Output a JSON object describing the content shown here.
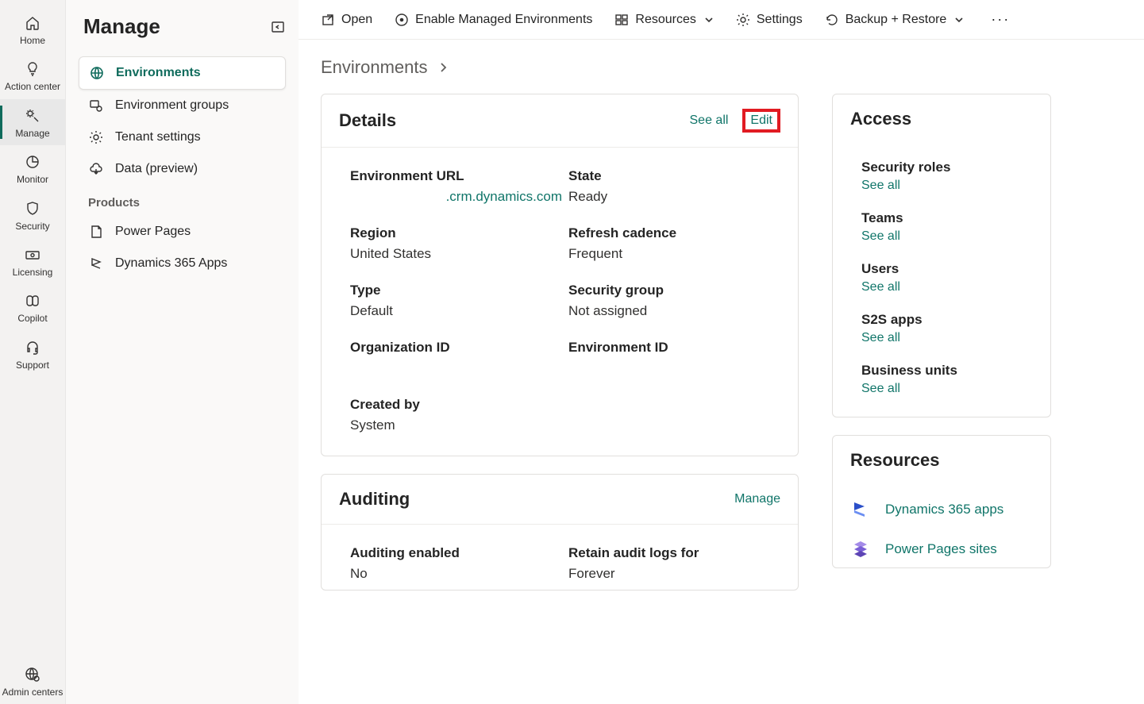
{
  "rail": {
    "items": [
      {
        "label": "Home"
      },
      {
        "label": "Action center"
      },
      {
        "label": "Manage"
      },
      {
        "label": "Monitor"
      },
      {
        "label": "Security"
      },
      {
        "label": "Licensing"
      },
      {
        "label": "Copilot"
      },
      {
        "label": "Support"
      }
    ],
    "footer": {
      "label": "Admin centers"
    }
  },
  "sidebar": {
    "title": "Manage",
    "items": [
      {
        "label": "Environments"
      },
      {
        "label": "Environment groups"
      },
      {
        "label": "Tenant settings"
      },
      {
        "label": "Data (preview)"
      }
    ],
    "section_products": "Products",
    "products": [
      {
        "label": "Power Pages"
      },
      {
        "label": "Dynamics 365 Apps"
      }
    ]
  },
  "toolbar": {
    "open": "Open",
    "enable_managed": "Enable Managed Environments",
    "resources": "Resources",
    "settings": "Settings",
    "backup_restore": "Backup + Restore"
  },
  "breadcrumb": {
    "root": "Environments"
  },
  "details": {
    "title": "Details",
    "see_all": "See all",
    "edit": "Edit",
    "fields": {
      "env_url_label": "Environment URL",
      "env_url_value": ".crm.dynamics.com",
      "state_label": "State",
      "state_value": "Ready",
      "region_label": "Region",
      "region_value": "United States",
      "refresh_label": "Refresh cadence",
      "refresh_value": "Frequent",
      "type_label": "Type",
      "type_value": "Default",
      "secgroup_label": "Security group",
      "secgroup_value": "Not assigned",
      "orgid_label": "Organization ID",
      "envid_label": "Environment ID",
      "createdby_label": "Created by",
      "createdby_value": "System"
    }
  },
  "auditing": {
    "title": "Auditing",
    "manage": "Manage",
    "enabled_label": "Auditing enabled",
    "enabled_value": "No",
    "retain_label": "Retain audit logs for",
    "retain_value": "Forever"
  },
  "access": {
    "title": "Access",
    "see_all": "See all",
    "blocks": [
      {
        "label": "Security roles"
      },
      {
        "label": "Teams"
      },
      {
        "label": "Users"
      },
      {
        "label": "S2S apps"
      },
      {
        "label": "Business units"
      }
    ]
  },
  "resources": {
    "title": "Resources",
    "links": [
      {
        "label": "Dynamics 365 apps"
      },
      {
        "label": "Power Pages sites"
      }
    ]
  }
}
